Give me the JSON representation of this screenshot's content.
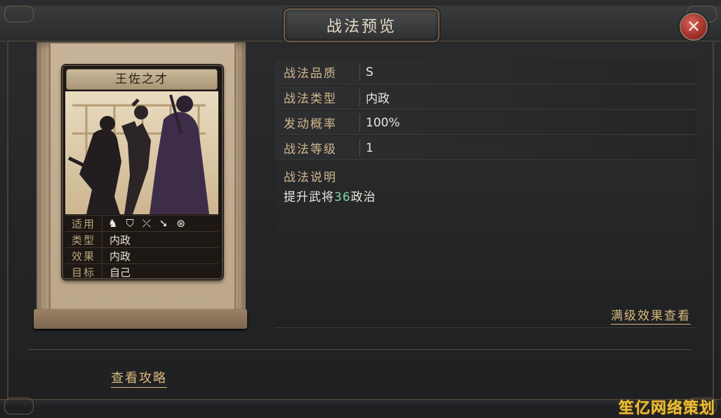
{
  "dialog": {
    "title": "战法预览",
    "close_symbol": "✕"
  },
  "card": {
    "title": "王佐之才",
    "rows": [
      {
        "key": "适用",
        "value": ""
      },
      {
        "key": "类型",
        "value": "内政"
      },
      {
        "key": "效果",
        "value": "内政"
      },
      {
        "key": "目标",
        "value": "自己"
      }
    ],
    "unit_icons": [
      "cavalry-icon",
      "shield-icon",
      "bow-icon",
      "spear-icon",
      "wheel-icon"
    ]
  },
  "details": [
    {
      "key": "战法品质",
      "value": "S"
    },
    {
      "key": "战法类型",
      "value": "内政"
    },
    {
      "key": "发动概率",
      "value": "100%"
    },
    {
      "key": "战法等级",
      "value": "1"
    }
  ],
  "description": {
    "title": "战法说明",
    "text_before": "提升武将",
    "number": "36",
    "text_after": "政治",
    "max_effect_link": "满级效果查看"
  },
  "guide_link": "查看攻略",
  "watermark": "笙亿网络策划",
  "colors": {
    "accent_gold": "#d9b97b",
    "highlight_green": "#7fd6a4",
    "close_red": "#a3302a"
  }
}
